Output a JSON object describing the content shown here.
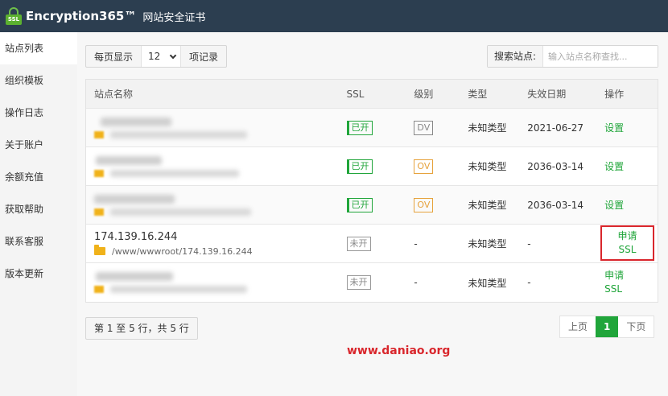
{
  "header": {
    "app_name": "Encryption365™",
    "app_subtitle": "网站安全证书",
    "logo_text": "SSL"
  },
  "sidebar": {
    "items": [
      {
        "label": "站点列表",
        "active": true
      },
      {
        "label": "组织模板"
      },
      {
        "label": "操作日志"
      },
      {
        "label": "关于账户"
      },
      {
        "label": "余额充值"
      },
      {
        "label": "获取帮助"
      },
      {
        "label": "联系客服"
      },
      {
        "label": "版本更新"
      }
    ]
  },
  "toolbar": {
    "per_page_label": "每页显示",
    "per_page_value": "12",
    "per_page_suffix": "项记录",
    "search_label": "搜索站点:",
    "search_placeholder": "输入站点名称查找..."
  },
  "table": {
    "columns": [
      "站点名称",
      "SSL",
      "级别",
      "类型",
      "失效日期",
      "操作"
    ],
    "rows": [
      {
        "name": "",
        "path": "",
        "ssl": "已开",
        "level": "DV",
        "type": "未知类型",
        "expiry": "2021-06-27",
        "action": "设置"
      },
      {
        "name": "",
        "path": "",
        "ssl": "已开",
        "level": "OV",
        "type": "未知类型",
        "expiry": "2036-03-14",
        "action": "设置"
      },
      {
        "name": "",
        "path": "",
        "ssl": "已开",
        "level": "OV",
        "type": "未知类型",
        "expiry": "2036-03-14",
        "action": "设置"
      },
      {
        "name": "174.139.16.244",
        "path": "/www/wwwroot/174.139.16.244",
        "ssl": "未开",
        "level": "-",
        "type": "未知类型",
        "expiry": "-",
        "action_line1": "申请",
        "action_line2": "SSL"
      },
      {
        "name": "",
        "path": "",
        "ssl": "未开",
        "level": "-",
        "type": "未知类型",
        "expiry": "-",
        "action_line1": "申请",
        "action_line2": "SSL"
      }
    ]
  },
  "footer": {
    "summary": "第 1 至 5 行，共 5 行",
    "prev": "上页",
    "current_page": "1",
    "next": "下页"
  },
  "watermark": "www.daniao.org",
  "colors": {
    "header_bg": "#2c3e50",
    "accent_green": "#20a53a",
    "ov_orange": "#e6a23c",
    "highlight_red": "#d9262c"
  }
}
